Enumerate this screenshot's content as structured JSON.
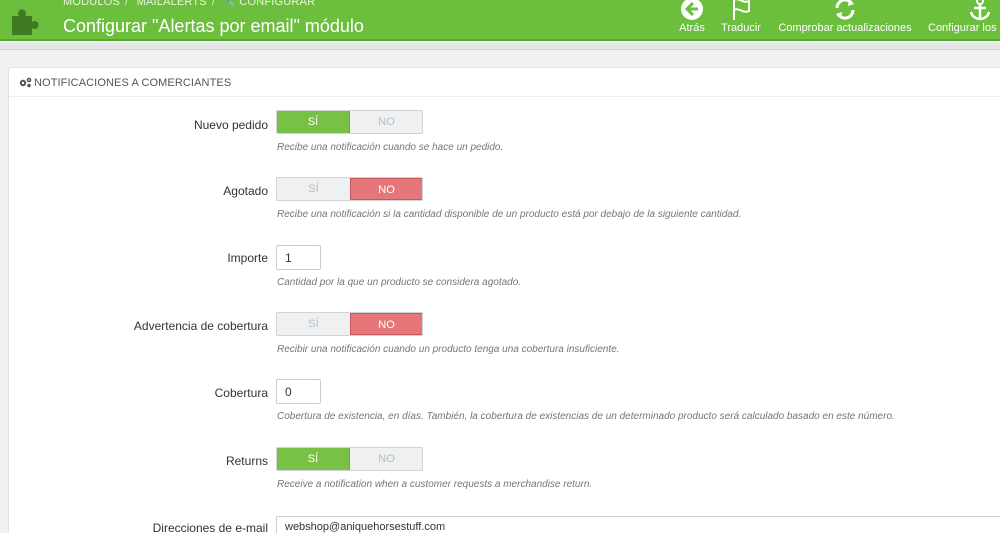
{
  "header": {
    "breadcrumb": [
      "MÓDULOS",
      "MAILALERTS",
      "CONFIGURAR"
    ],
    "title": "Configurar \"Alertas por email\" módulo",
    "toolbar": [
      {
        "label": "Atrás",
        "icon": "back-circle-icon"
      },
      {
        "label": "Traducir",
        "icon": "flag-icon"
      },
      {
        "label": "Comprobar actualizaciones",
        "icon": "refresh-icon"
      },
      {
        "label": "Configurar los",
        "icon": "anchor-icon"
      }
    ],
    "color": "#6cbf3d"
  },
  "panel": {
    "heading": "NOTIFICACIONES A COMERCIANTES",
    "heading_icon": "gears-icon"
  },
  "switch_labels": {
    "yes": "SÍ",
    "no": "NO"
  },
  "fields": {
    "nuevo_pedido": {
      "label": "Nuevo pedido",
      "value": "SÍ",
      "help": "Recibe una notificación cuando se hace un pedido."
    },
    "agotado": {
      "label": "Agotado",
      "value": "NO",
      "help": "Recibe una notificación si la cantidad disponible de un producto está por debajo de la siguiente cantidad."
    },
    "importe": {
      "label": "Importe",
      "value": "1",
      "help": "Cantidad por la que un producto se considera agotado."
    },
    "advertencia_cobertura": {
      "label": "Advertencia de cobertura",
      "value": "NO",
      "help": "Recibir una notificación cuando un producto tenga una cobertura insuficiente."
    },
    "cobertura": {
      "label": "Cobertura",
      "value": "0",
      "help": "Cobertura de existencia, en días. También, la cobertura de existencias de un determinado producto será calculado basado en este número."
    },
    "returns": {
      "label": "Returns",
      "value": "SÍ",
      "help": "Receive a notification when a customer requests a merchandise return."
    },
    "direcciones_email": {
      "label": "Direcciones de e-mail",
      "value": "webshop@aniquehorsestuff.com"
    }
  },
  "colors": {
    "yes": "#78c145",
    "no": "#e5777a"
  }
}
